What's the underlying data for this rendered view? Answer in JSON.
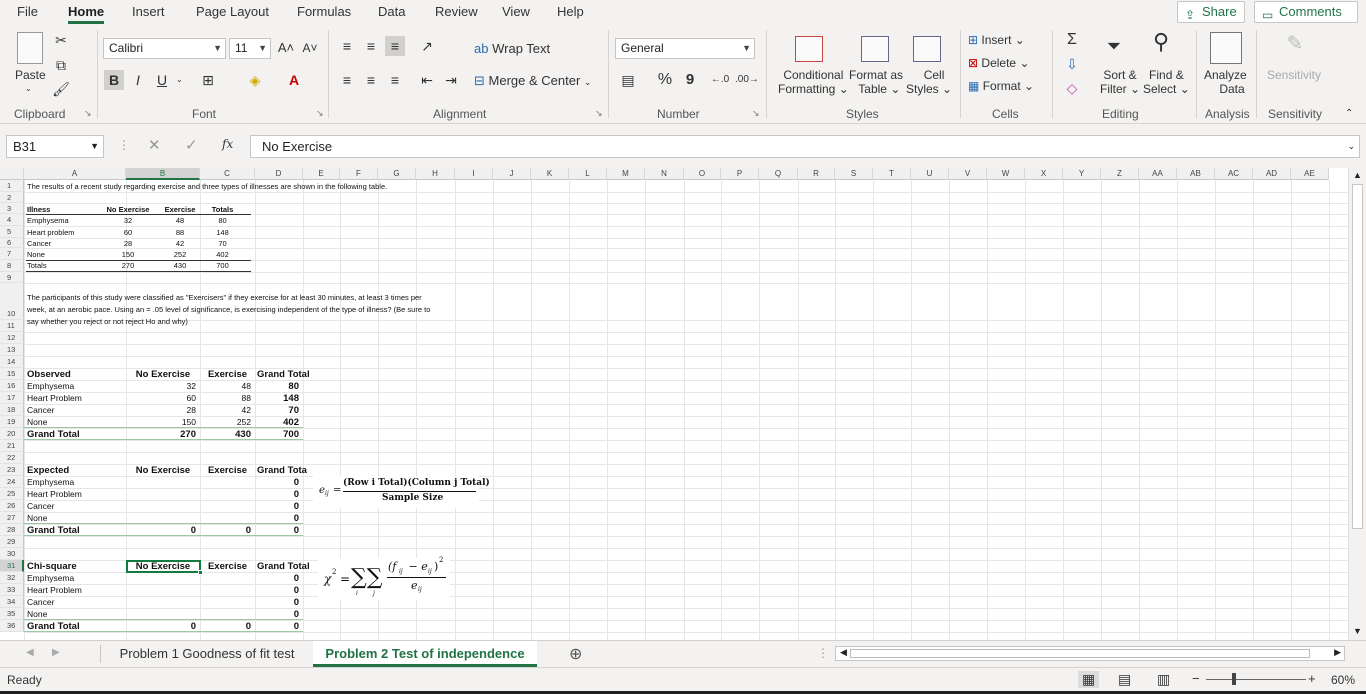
{
  "menu": {
    "tabs": [
      "File",
      "Home",
      "Insert",
      "Page Layout",
      "Formulas",
      "Data",
      "Review",
      "View",
      "Help"
    ],
    "active_tab": "Home",
    "share_label": "Share",
    "comments_label": "Comments"
  },
  "ribbon": {
    "clipboard": {
      "paste": "Paste",
      "label": "Clipboard"
    },
    "font": {
      "name": "Calibri",
      "size": "11",
      "bold": "B",
      "italic": "I",
      "underline": "U",
      "label": "Font"
    },
    "alignment": {
      "wrap_text": "Wrap Text",
      "merge_center": "Merge & Center",
      "label": "Alignment"
    },
    "number": {
      "format": "General",
      "percent": "%",
      "comma": "9",
      "label": "Number"
    },
    "styles": {
      "conditional_1": "Conditional",
      "conditional_2": "Formatting",
      "format_table_1": "Format as",
      "format_table_2": "Table",
      "cell_styles_1": "Cell",
      "cell_styles_2": "Styles",
      "label": "Styles"
    },
    "cells": {
      "insert": "Insert",
      "delete": "Delete",
      "format": "Format",
      "label": "Cells"
    },
    "editing": {
      "sort_1": "Sort &",
      "sort_2": "Filter",
      "find_1": "Find &",
      "find_2": "Select",
      "label": "Editing"
    },
    "analysis": {
      "analyze_1": "Analyze",
      "analyze_2": "Data",
      "label": "Analysis"
    },
    "sensitivity": {
      "button": "Sensitivity",
      "label": "Sensitivity"
    }
  },
  "formula_bar": {
    "name_box": "B31",
    "fx": "fx",
    "content": "No Exercise"
  },
  "columns": [
    "A",
    "B",
    "C",
    "D",
    "E",
    "F",
    "G",
    "H",
    "I",
    "J",
    "K",
    "L",
    "M",
    "N",
    "O",
    "P",
    "Q",
    "R",
    "S",
    "T",
    "U",
    "V",
    "W",
    "X",
    "Y",
    "Z",
    "AA",
    "AB",
    "AC",
    "AD",
    "AE"
  ],
  "rows": [
    "1",
    "2",
    "3",
    "4",
    "5",
    "6",
    "7",
    "8",
    "9",
    "10",
    "11",
    "12",
    "13",
    "14",
    "15",
    "16",
    "17",
    "18",
    "19",
    "20",
    "21",
    "22",
    "23",
    "24",
    "25",
    "26",
    "27",
    "28",
    "29",
    "30",
    "31",
    "32",
    "33",
    "34",
    "35",
    "36"
  ],
  "sheet": {
    "intro": "The results of a recent study regarding exercise and three types of illnesses are shown in the following table.",
    "small_table": {
      "headers": [
        "Illness",
        "No Exercise",
        "Exercise",
        "Totals"
      ],
      "rows": [
        [
          "Emphysema",
          "32",
          "48",
          "80"
        ],
        [
          "Heart problem",
          "60",
          "88",
          "148"
        ],
        [
          "Cancer",
          "28",
          "42",
          "70"
        ],
        [
          "None",
          "150",
          "252",
          "402"
        ],
        [
          "Totals",
          "270",
          "430",
          "700"
        ]
      ]
    },
    "question_lines": [
      "The participants of this study were classified as \"Exercisers\" if they exercise for at least 30 minutes, at least 3 times per",
      "week, at an aerobic pace. Using an   = .05 level of significance, is exercising independent of the type of illness? (Be sure to",
      "say whether you reject or not reject Ho and why)"
    ],
    "observed": {
      "headers": [
        "Observed",
        "No Exercise",
        "Exercise",
        "Grand Total"
      ],
      "rows": [
        [
          "Emphysema",
          "32",
          "48",
          "80"
        ],
        [
          "Heart Problem",
          "60",
          "88",
          "148"
        ],
        [
          "Cancer",
          "28",
          "42",
          "70"
        ],
        [
          "None",
          "150",
          "252",
          "402"
        ],
        [
          "Grand Total",
          "270",
          "430",
          "700"
        ]
      ]
    },
    "expected": {
      "headers": [
        "Expected",
        "No Exercise",
        "Exercise",
        "Grand Tota"
      ],
      "rows": [
        [
          "Emphysema",
          "",
          "",
          "0"
        ],
        [
          "Heart Problem",
          "",
          "",
          "0"
        ],
        [
          "Cancer",
          "",
          "",
          "0"
        ],
        [
          "None",
          "",
          "",
          "0"
        ],
        [
          "Grand Total",
          "0",
          "0",
          "0"
        ]
      ],
      "formula_numerator": "(Row i Total)(Column j Total)",
      "formula_denominator": "Sample Size",
      "formula_lhs": "e",
      "formula_sub": "ij"
    },
    "chisq": {
      "headers": [
        "Chi-square",
        "No Exercise",
        "Exercise",
        "Grand Total"
      ],
      "rows": [
        [
          "Emphysema",
          "",
          "",
          "0"
        ],
        [
          "Heart Problem",
          "",
          "",
          "0"
        ],
        [
          "Cancer",
          "",
          "",
          "0"
        ],
        [
          "None",
          "",
          "",
          "0"
        ],
        [
          "Grand Total",
          "0",
          "0",
          "0"
        ]
      ],
      "formula_lhs": "χ",
      "formula_sup": "2",
      "formula_eq": "=",
      "formula_sum": "∑∑",
      "formula_idx_i": "i",
      "formula_idx_j": "j",
      "formula_num": "(f",
      "formula_num_sub": "ij",
      "formula_num_mid": " − e",
      "formula_num_end": ")",
      "formula_num_sup": "2",
      "formula_den": "e",
      "formula_den_sub": "ij"
    }
  },
  "sheet_tabs": [
    "Problem 1 Goodness of fit test",
    "Problem 2 Test of independence"
  ],
  "active_sheet": "Problem 2 Test of independence",
  "status": {
    "ready": "Ready",
    "zoom": "60%"
  },
  "colors": {
    "accent": "#217346",
    "selection": "#107c41"
  }
}
